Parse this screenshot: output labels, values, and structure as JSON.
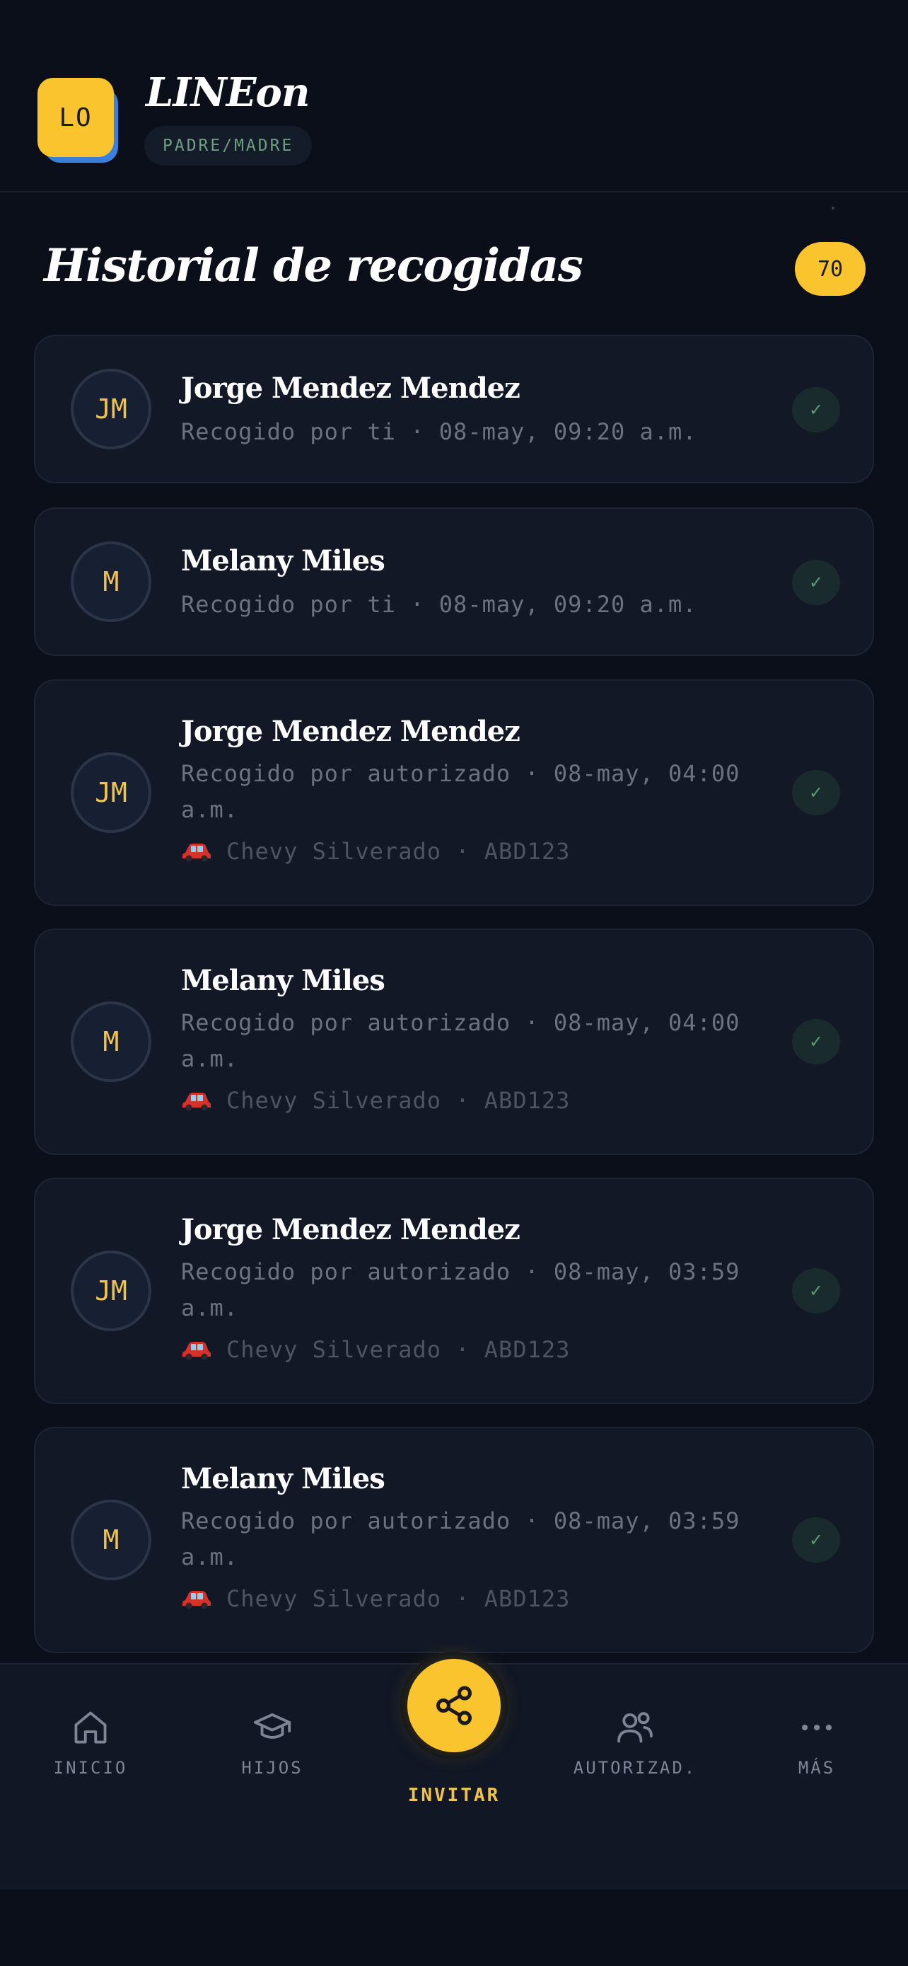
{
  "app": {
    "logo_initials": "LO",
    "name": "LINEon",
    "role": "PADRE/MADRE"
  },
  "page": {
    "title": "Historial de recogidas",
    "count": "70"
  },
  "records": [
    {
      "initials": "JM",
      "name": "Jorge Mendez Mendez",
      "detail": "Recogido por ti · 08-may, 09:20 a.m.",
      "vehicle": ""
    },
    {
      "initials": "M",
      "name": "Melany Miles",
      "detail": "Recogido por ti · 08-may, 09:20 a.m.",
      "vehicle": ""
    },
    {
      "initials": "JM",
      "name": "Jorge Mendez Mendez",
      "detail": "Recogido por autorizado · 08-may, 04:00 a.m.",
      "vehicle": "Chevy Silverado · ABD123"
    },
    {
      "initials": "M",
      "name": "Melany Miles",
      "detail": "Recogido por autorizado · 08-may, 04:00 a.m.",
      "vehicle": "Chevy Silverado · ABD123"
    },
    {
      "initials": "JM",
      "name": "Jorge Mendez Mendez",
      "detail": "Recogido por autorizado · 08-may, 03:59 a.m.",
      "vehicle": "Chevy Silverado · ABD123"
    },
    {
      "initials": "M",
      "name": "Melany Miles",
      "detail": "Recogido por autorizado · 08-may, 03:59 a.m.",
      "vehicle": "Chevy Silverado · ABD123"
    }
  ],
  "status_icon": "check-icon",
  "status_glyph": "✓",
  "nav": {
    "home": "INICIO",
    "children": "HIJOS",
    "invite": "INVITAR",
    "authorized": "AUTORIZAD.",
    "more": "MÁS"
  },
  "colors": {
    "background": "#0a0f1a",
    "accent": "#f9c42d",
    "card": "#121826",
    "success": "#5e9c7b",
    "car": "#d8312b"
  }
}
